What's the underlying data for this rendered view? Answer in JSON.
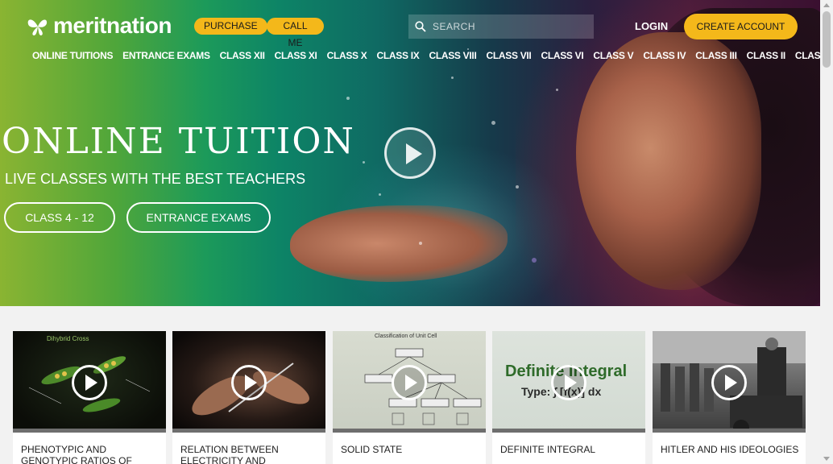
{
  "header": {
    "logo_text": "meritnation",
    "purchase_label": "PURCHASE",
    "call_me_label": "CALL ME",
    "search": {
      "placeholder": "SEARCH",
      "value": ""
    },
    "login_label": "LOGIN",
    "create_account_label": "CREATE ACCOUNT"
  },
  "nav": {
    "items": [
      "ONLINE TUITIONS",
      "ENTRANCE EXAMS",
      "CLASS XII",
      "CLASS XI",
      "CLASS X",
      "CLASS IX",
      "CLASS VIII",
      "CLASS VII",
      "CLASS VI",
      "CLASS V",
      "CLASS IV",
      "CLASS III",
      "CLASS II",
      "CLASS I"
    ]
  },
  "hero": {
    "title": "ONLINE TUITION",
    "subtitle": "LIVE CLASSES WITH THE BEST TEACHERS",
    "buttons": [
      "CLASS 4 - 12",
      "ENTRANCE EXAMS"
    ]
  },
  "videos": [
    {
      "title": "PHENOTYPIC AND GENOTYPIC RATIOS OF DIHYBRID CROSS",
      "thumb_text": "Dihybrid Cross"
    },
    {
      "title": "RELATION BETWEEN ELECTRICITY AND",
      "thumb_text": ""
    },
    {
      "title": "SOLID STATE",
      "thumb_text": "Classification of Unit Cell"
    },
    {
      "title": "DEFINITE INTEGRAL",
      "thumb_text": "Definite Integral",
      "thumb_sub": "Type: ∫ [f(x)] dx"
    },
    {
      "title": "HITLER AND HIS IDEOLOGIES",
      "thumb_text": ""
    }
  ],
  "colors": {
    "accent_yellow": "#f4b81a",
    "text_dark": "#1e1e1e",
    "page_bg": "#f2f2f2"
  }
}
